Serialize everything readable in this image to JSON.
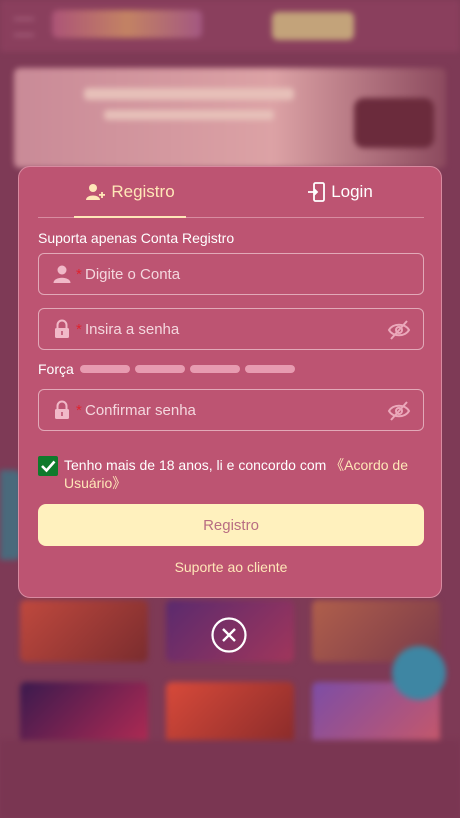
{
  "modal": {
    "tabs": [
      {
        "label": "Registro",
        "icon": "user-add-icon",
        "active": true
      },
      {
        "label": "Login",
        "icon": "login-icon",
        "active": false
      }
    ],
    "hint": "Suporta apenas Conta Registro",
    "fields": {
      "account": {
        "placeholder": "Digite o Conta",
        "required_mark": "*",
        "icon": "user-icon"
      },
      "password": {
        "placeholder": "Insira a senha",
        "required_mark": "*",
        "icon": "lock-icon",
        "toggle_icon": "eye-off-icon"
      },
      "confirm": {
        "placeholder": "Confirmar senha",
        "required_mark": "*",
        "icon": "lock-icon",
        "toggle_icon": "eye-off-icon"
      }
    },
    "strength": {
      "label": "Força",
      "segments": 4
    },
    "agreement": {
      "checked": true,
      "text": "Tenho mais de 18 anos, li e concordo com ",
      "link": "《Acordo de Usuário》"
    },
    "submit_label": "Registro",
    "support_label": "Suporte ao cliente"
  },
  "colors": {
    "modal_bg": "#bd5472",
    "accent": "#ffe7b8",
    "button_bg": "#fff1be",
    "required": "#e0232e",
    "checkbox": "#0f7a2c"
  }
}
